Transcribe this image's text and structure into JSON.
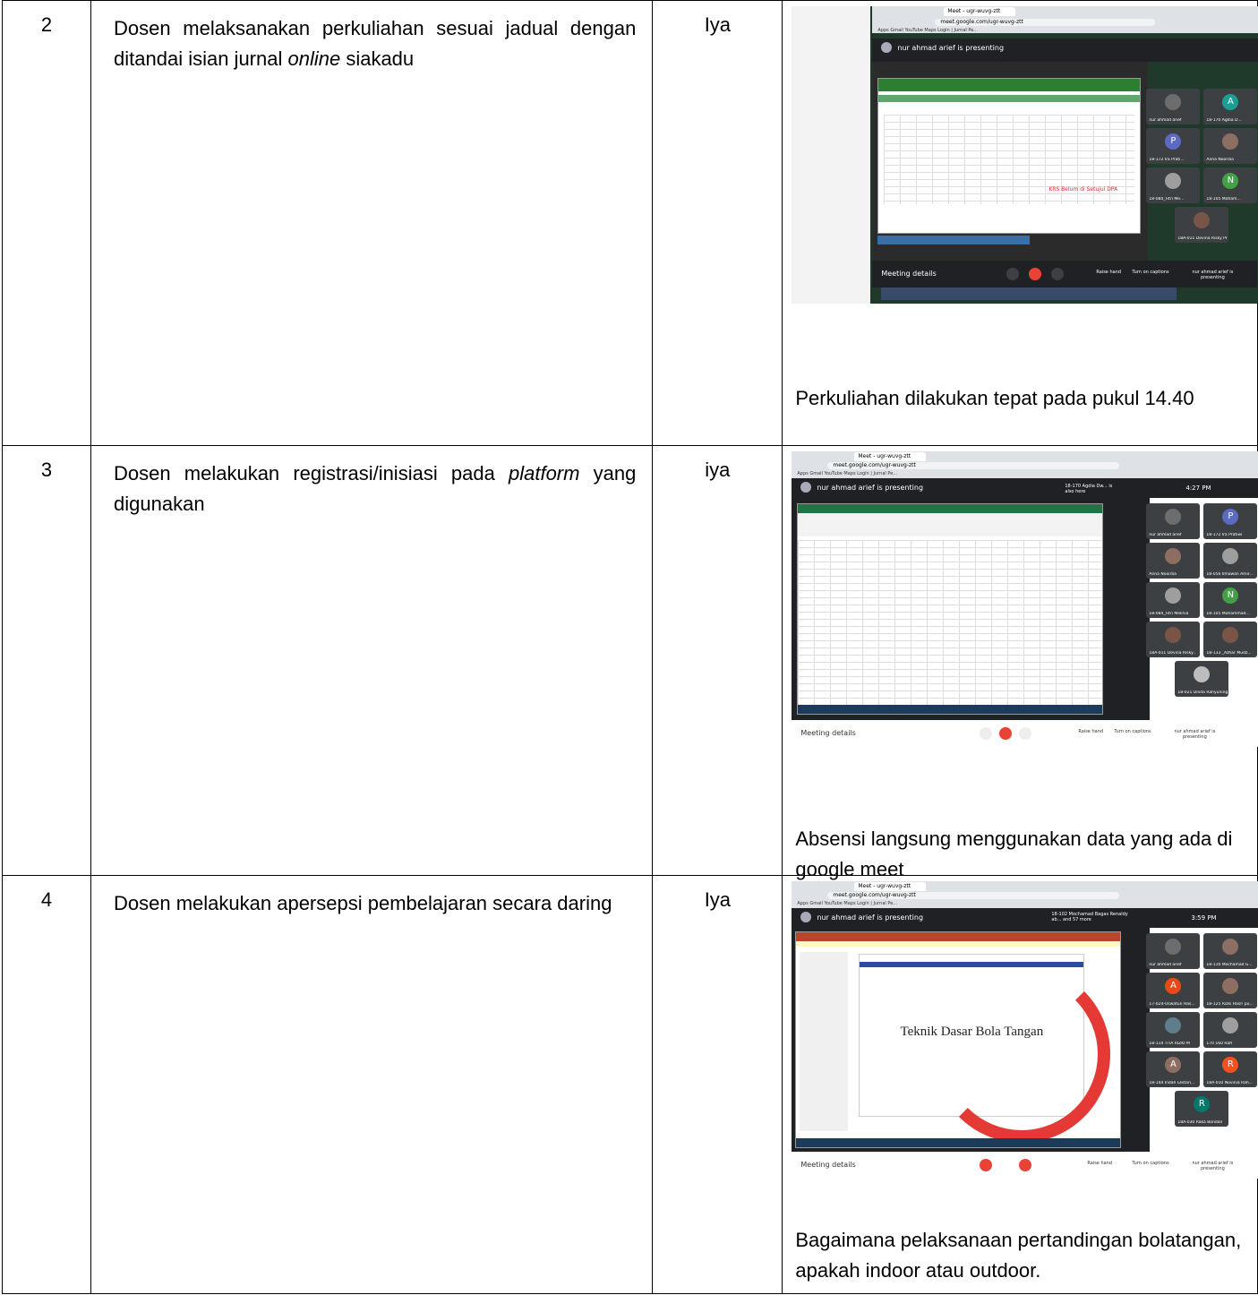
{
  "rows": [
    {
      "no": "2",
      "description_parts": [
        "Dosen melaksanakan perkuliahan sesuai jadual dengan ditandai isian jurnal ",
        "online",
        " siakadu"
      ],
      "status": "Iya",
      "caption": "Perkuliahan dilakukan tepat pada pukul 14.40",
      "screenshot": {
        "tab_title": "Meet - ugr-wuvg-ztt",
        "url": "meet.google.com/ugr-wuvg-ztt",
        "bookmarks": "Apps   Gmail   YouTube   Maps   Login | Jurnal Pe...",
        "presenter": "nur ahmad arief is presenting",
        "meeting_details": "Meeting details",
        "raise_hand": "Raise hand",
        "captions": "Turn on captions",
        "presenting": "nur ahmad arief is presenting",
        "inner_banner": "KRS Belum di Setujui DPA",
        "participants": [
          {
            "initial": "",
            "name": "nur ahmad arief",
            "color": "#6d6d6d"
          },
          {
            "initial": "A",
            "name": "18-170 Agdia D...",
            "color": "#1a9e95"
          },
          {
            "initial": "P",
            "name": "18-172 Ira Prati...",
            "color": "#5c6bc0"
          },
          {
            "initial": "",
            "name": "Anna Noordia",
            "color": "#8d6e63"
          },
          {
            "initial": "",
            "name": "18-084_Fitri Me...",
            "color": "#9e9e9e"
          },
          {
            "initial": "N",
            "name": "18-105 Moham...",
            "color": "#43a047"
          },
          {
            "initial": "",
            "name": "18A-011 Devina Risky Pratiwi",
            "color": "#795548"
          }
        ]
      }
    },
    {
      "no": "3",
      "description_parts": [
        "Dosen melakukan registrasi/inisiasi pada ",
        "platform",
        " yang digunakan"
      ],
      "status": "iya",
      "caption": "Absensi langsung menggunakan data yang ada di google meet",
      "screenshot": {
        "tab_title": "Meet - ugr-wuvg-ztt",
        "url": "meet.google.com/ugr-wuvg-ztt",
        "bookmarks": "Apps   Gmail   YouTube   Maps   Login | Jurnal Pe...",
        "presenter": "nur ahmad arief is presenting",
        "time": "4:27 PM",
        "joined": "18-170 Agdia Dw... is also here",
        "meeting_details": "Meeting details",
        "raise_hand": "Raise hand",
        "captions": "Turn on captions",
        "presenting": "nur ahmad arief is presenting",
        "participants": [
          {
            "initial": "",
            "name": "nur ahmad arief",
            "color": "#6d6d6d"
          },
          {
            "initial": "P",
            "name": "18-172 Ira Pratiwi",
            "color": "#5c6bc0"
          },
          {
            "initial": "",
            "name": "Anna Noordia",
            "color": "#8d6e63"
          },
          {
            "initial": "",
            "name": "18-056 Ilmawan Amir...",
            "color": "#9e9e9e"
          },
          {
            "initial": "",
            "name": "18-084_Fitri Melinia",
            "color": "#9e9e9e"
          },
          {
            "initial": "N",
            "name": "18-105 Mohammad...",
            "color": "#43a047"
          },
          {
            "initial": "",
            "name": "18A-011 Devina Risky...",
            "color": "#795548"
          },
          {
            "initial": "",
            "name": "18-133 _Azhar Mudz...",
            "color": "#795548"
          },
          {
            "initial": "",
            "name": "18-021 Dinda Rahyuning",
            "color": "#bdbdbd"
          }
        ]
      }
    },
    {
      "no": "4",
      "description_parts": [
        "Dosen melakukan apersepsi pembelajaran secara daring",
        "",
        ""
      ],
      "status": "Iya",
      "caption": "Bagaimana pelaksanaan pertandingan bolatangan, apakah indoor atau outdoor.",
      "screenshot": {
        "tab_title": "Meet - ugr-wuvg-ztt",
        "url": "meet.google.com/ugr-wuvg-ztt",
        "bookmarks": "Apps   Gmail   YouTube   Maps   Login | Jurnal Pe...",
        "presenter": "nur ahmad arief is presenting",
        "time": "3:59 PM",
        "joined": "18-102 Mochamad Bagas Renaldy ab... and 57 more",
        "slide_title": "Teknik Dasar Bola Tangan",
        "meeting_details": "Meeting details",
        "raise_hand": "Raise hand",
        "captions": "Turn on captions",
        "presenting": "nur ahmad arief is presenting",
        "participants": [
          {
            "initial": "",
            "name": "nur ahmad arief",
            "color": "#6d6d6d"
          },
          {
            "initial": "",
            "name": "18-110 Mochamad G...",
            "color": "#8d6e63"
          },
          {
            "initial": "A",
            "name": "17-024-Uswatun Has...",
            "color": "#e64a19"
          },
          {
            "initial": "",
            "name": "18-125 Rizki Hasri pu...",
            "color": "#8d6e63"
          },
          {
            "initial": "",
            "name": "18-114 TITA RIZKI M",
            "color": "#607d8b"
          },
          {
            "initial": "",
            "name": "170 160 Rafi",
            "color": "#9e9e9e"
          },
          {
            "initial": "A",
            "name": "18-144 Indah Lestari...",
            "color": "#8d6e63"
          },
          {
            "initial": "R",
            "name": "18A-010 Novinia Rah...",
            "color": "#f4511e"
          },
          {
            "initial": "R",
            "name": "18A-030 Raka Bondan",
            "color": "#00796b"
          }
        ]
      }
    }
  ]
}
